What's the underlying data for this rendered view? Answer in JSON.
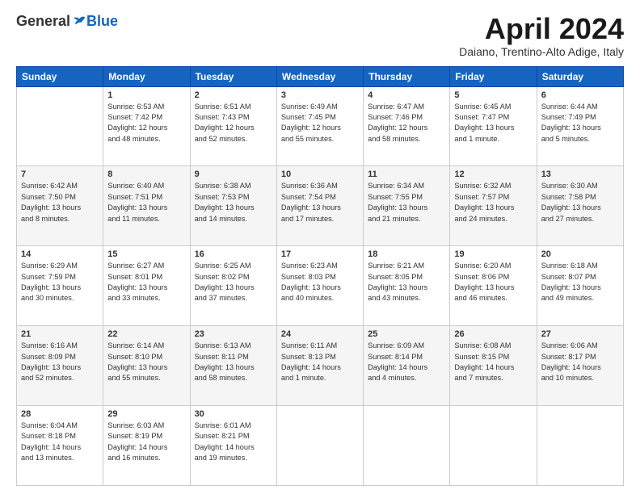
{
  "logo": {
    "general": "General",
    "blue": "Blue"
  },
  "header": {
    "month_year": "April 2024",
    "location": "Daiano, Trentino-Alto Adige, Italy"
  },
  "days_of_week": [
    "Sunday",
    "Monday",
    "Tuesday",
    "Wednesday",
    "Thursday",
    "Friday",
    "Saturday"
  ],
  "weeks": [
    {
      "shaded": false,
      "days": [
        {
          "number": "",
          "info": ""
        },
        {
          "number": "1",
          "info": "Sunrise: 6:53 AM\nSunset: 7:42 PM\nDaylight: 12 hours\nand 48 minutes."
        },
        {
          "number": "2",
          "info": "Sunrise: 6:51 AM\nSunset: 7:43 PM\nDaylight: 12 hours\nand 52 minutes."
        },
        {
          "number": "3",
          "info": "Sunrise: 6:49 AM\nSunset: 7:45 PM\nDaylight: 12 hours\nand 55 minutes."
        },
        {
          "number": "4",
          "info": "Sunrise: 6:47 AM\nSunset: 7:46 PM\nDaylight: 12 hours\nand 58 minutes."
        },
        {
          "number": "5",
          "info": "Sunrise: 6:45 AM\nSunset: 7:47 PM\nDaylight: 13 hours\nand 1 minute."
        },
        {
          "number": "6",
          "info": "Sunrise: 6:44 AM\nSunset: 7:49 PM\nDaylight: 13 hours\nand 5 minutes."
        }
      ]
    },
    {
      "shaded": true,
      "days": [
        {
          "number": "7",
          "info": "Sunrise: 6:42 AM\nSunset: 7:50 PM\nDaylight: 13 hours\nand 8 minutes."
        },
        {
          "number": "8",
          "info": "Sunrise: 6:40 AM\nSunset: 7:51 PM\nDaylight: 13 hours\nand 11 minutes."
        },
        {
          "number": "9",
          "info": "Sunrise: 6:38 AM\nSunset: 7:53 PM\nDaylight: 13 hours\nand 14 minutes."
        },
        {
          "number": "10",
          "info": "Sunrise: 6:36 AM\nSunset: 7:54 PM\nDaylight: 13 hours\nand 17 minutes."
        },
        {
          "number": "11",
          "info": "Sunrise: 6:34 AM\nSunset: 7:55 PM\nDaylight: 13 hours\nand 21 minutes."
        },
        {
          "number": "12",
          "info": "Sunrise: 6:32 AM\nSunset: 7:57 PM\nDaylight: 13 hours\nand 24 minutes."
        },
        {
          "number": "13",
          "info": "Sunrise: 6:30 AM\nSunset: 7:58 PM\nDaylight: 13 hours\nand 27 minutes."
        }
      ]
    },
    {
      "shaded": false,
      "days": [
        {
          "number": "14",
          "info": "Sunrise: 6:29 AM\nSunset: 7:59 PM\nDaylight: 13 hours\nand 30 minutes."
        },
        {
          "number": "15",
          "info": "Sunrise: 6:27 AM\nSunset: 8:01 PM\nDaylight: 13 hours\nand 33 minutes."
        },
        {
          "number": "16",
          "info": "Sunrise: 6:25 AM\nSunset: 8:02 PM\nDaylight: 13 hours\nand 37 minutes."
        },
        {
          "number": "17",
          "info": "Sunrise: 6:23 AM\nSunset: 8:03 PM\nDaylight: 13 hours\nand 40 minutes."
        },
        {
          "number": "18",
          "info": "Sunrise: 6:21 AM\nSunset: 8:05 PM\nDaylight: 13 hours\nand 43 minutes."
        },
        {
          "number": "19",
          "info": "Sunrise: 6:20 AM\nSunset: 8:06 PM\nDaylight: 13 hours\nand 46 minutes."
        },
        {
          "number": "20",
          "info": "Sunrise: 6:18 AM\nSunset: 8:07 PM\nDaylight: 13 hours\nand 49 minutes."
        }
      ]
    },
    {
      "shaded": true,
      "days": [
        {
          "number": "21",
          "info": "Sunrise: 6:16 AM\nSunset: 8:09 PM\nDaylight: 13 hours\nand 52 minutes."
        },
        {
          "number": "22",
          "info": "Sunrise: 6:14 AM\nSunset: 8:10 PM\nDaylight: 13 hours\nand 55 minutes."
        },
        {
          "number": "23",
          "info": "Sunrise: 6:13 AM\nSunset: 8:11 PM\nDaylight: 13 hours\nand 58 minutes."
        },
        {
          "number": "24",
          "info": "Sunrise: 6:11 AM\nSunset: 8:13 PM\nDaylight: 14 hours\nand 1 minute."
        },
        {
          "number": "25",
          "info": "Sunrise: 6:09 AM\nSunset: 8:14 PM\nDaylight: 14 hours\nand 4 minutes."
        },
        {
          "number": "26",
          "info": "Sunrise: 6:08 AM\nSunset: 8:15 PM\nDaylight: 14 hours\nand 7 minutes."
        },
        {
          "number": "27",
          "info": "Sunrise: 6:06 AM\nSunset: 8:17 PM\nDaylight: 14 hours\nand 10 minutes."
        }
      ]
    },
    {
      "shaded": false,
      "days": [
        {
          "number": "28",
          "info": "Sunrise: 6:04 AM\nSunset: 8:18 PM\nDaylight: 14 hours\nand 13 minutes."
        },
        {
          "number": "29",
          "info": "Sunrise: 6:03 AM\nSunset: 8:19 PM\nDaylight: 14 hours\nand 16 minutes."
        },
        {
          "number": "30",
          "info": "Sunrise: 6:01 AM\nSunset: 8:21 PM\nDaylight: 14 hours\nand 19 minutes."
        },
        {
          "number": "",
          "info": ""
        },
        {
          "number": "",
          "info": ""
        },
        {
          "number": "",
          "info": ""
        },
        {
          "number": "",
          "info": ""
        }
      ]
    }
  ]
}
